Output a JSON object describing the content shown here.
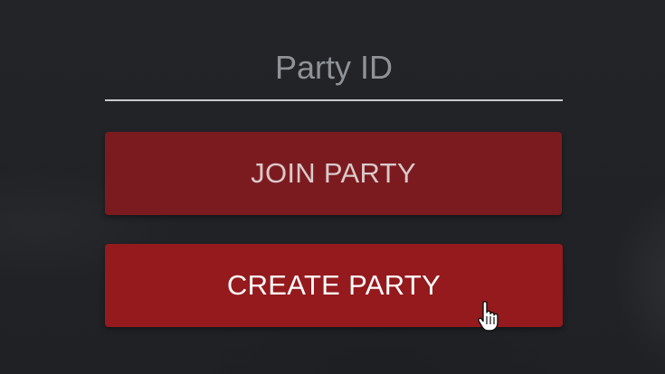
{
  "party_id": {
    "placeholder": "Party ID",
    "value": ""
  },
  "buttons": {
    "join_label": "JOIN PARTY",
    "create_label": "CREATE PARTY"
  },
  "colors": {
    "background": "#202226",
    "join_button": "#7c1b1f",
    "create_button": "#951a1d",
    "underline": "#c7c9cd"
  },
  "icons": {
    "cursor": "hand-pointer-icon"
  }
}
